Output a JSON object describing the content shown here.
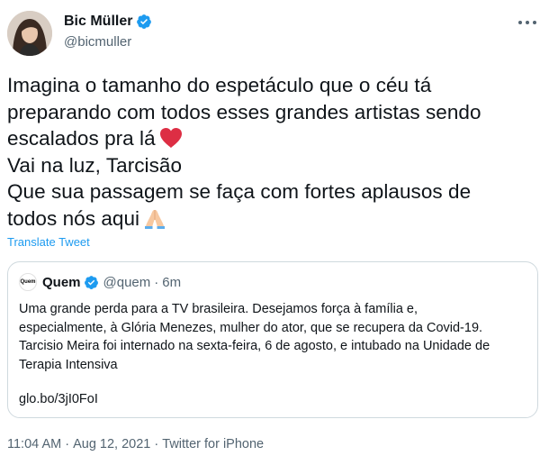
{
  "author": {
    "display_name": "Bic Müller",
    "handle": "@bicmuller",
    "avatar_icon": "profile-photo",
    "verified": true
  },
  "tweet": {
    "lines": [
      "Imagina o tamanho do espetáculo que o céu tá",
      "preparando com todos esses grandes artistas sendo",
      "escalados pra lá",
      "Vai na luz, Tarcisão",
      "Que sua passagem se faça com fortes aplausos de",
      "todos nós aqui"
    ],
    "emoji_heart": "red-heart-icon",
    "emoji_hands": "folded-hands-icon"
  },
  "translate_label": "Translate Tweet",
  "quote": {
    "avatar_text": "Quem",
    "name": "Quem",
    "handle": "@quem",
    "separator": "·",
    "time": "6m",
    "lines": [
      "Uma grande perda para a TV brasileira. Desejamos força à família e,",
      "especialmente, à Glória Menezes, mulher do ator, que se recupera da Covid-19.",
      "Tarcisio Meira foi internado na sexta-feira, 6 de agosto, e intubado na Unidade de",
      "Terapia Intensiva"
    ],
    "link": "glo.bo/3jI0FoI"
  },
  "meta": {
    "time": "11:04 AM",
    "sep1": " · ",
    "date": "Aug 12, 2021",
    "sep2": " · ",
    "source": "Twitter for iPhone"
  },
  "colors": {
    "accent": "#1d9bf0",
    "text": "#0f1419",
    "secondary": "#536471",
    "border": "#cfd9de"
  }
}
